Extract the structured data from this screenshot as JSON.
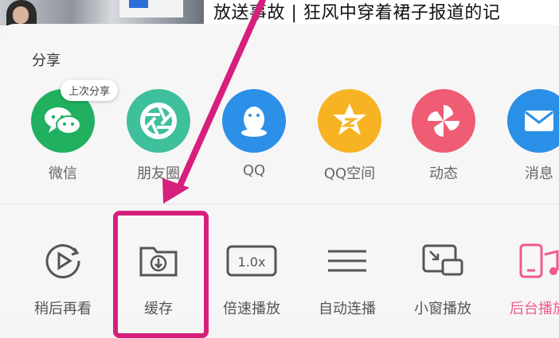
{
  "top": {
    "headline": "放送事故 | 狂风中穿着裙子报道的记"
  },
  "share": {
    "title": "分享",
    "last_share_bubble": "上次分享",
    "apps": [
      {
        "label": "微信",
        "color": "#20b05f",
        "icon": "wechat-icon"
      },
      {
        "label": "朋友圈",
        "color": "#3fc09d",
        "icon": "moments-icon"
      },
      {
        "label": "QQ",
        "color": "#2c8fe8",
        "icon": "qq-icon"
      },
      {
        "label": "QQ空间",
        "color": "#f7b322",
        "icon": "qzone-icon"
      },
      {
        "label": "动态",
        "color": "#ef5c73",
        "icon": "feed-icon"
      },
      {
        "label": "消息",
        "color": "#2a8fe6",
        "icon": "message-icon"
      }
    ]
  },
  "tools": [
    {
      "label": "稍后再看",
      "icon": "watch-later-icon"
    },
    {
      "label": "缓存",
      "icon": "cache-icon"
    },
    {
      "label": "倍速播放",
      "icon": "speed-icon",
      "speed_text": "1.0x"
    },
    {
      "label": "自动连播",
      "icon": "autoplay-icon"
    },
    {
      "label": "小窗播放",
      "icon": "picture-in-picture-icon"
    },
    {
      "label": "后台播放",
      "icon": "background-play-icon"
    }
  ],
  "colors": {
    "accent_pink": "#d61f7d",
    "bg_play_pink": "#f05a8a"
  }
}
